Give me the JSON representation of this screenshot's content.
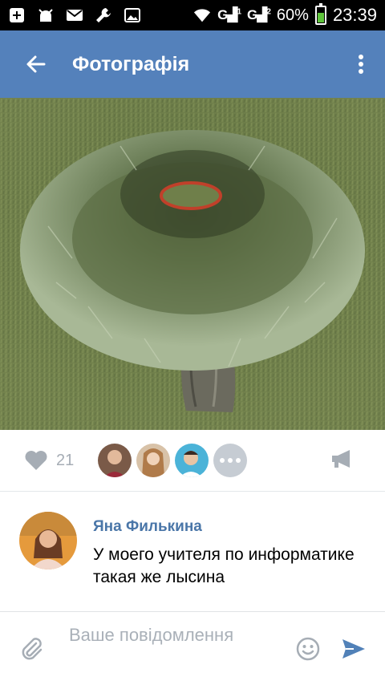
{
  "status_bar": {
    "battery": "60%",
    "time": "23:39",
    "signal_1": "G",
    "signal_2": "G",
    "signal_sim1": "1",
    "signal_sim2": "2",
    "icons": [
      "add-icon",
      "android-debug-icon",
      "mail-icon",
      "wrench-icon",
      "image-icon",
      "wifi-icon",
      "signal-icon",
      "signal-icon",
      "battery-icon"
    ],
    "battery_color": "#5ec43b"
  },
  "app_bar": {
    "title": "Фотографія",
    "back_icon": "arrow-left-icon",
    "menu_icon": "more-vertical-icon",
    "color": "#5481bb"
  },
  "photo": {
    "subject": "tree-photo"
  },
  "actions": {
    "like_count": "21",
    "like_icon": "heart-icon",
    "share_icon": "megaphone-icon",
    "likers_more_icon": "more-horizontal-icon"
  },
  "comment": {
    "author": "Яна Филькина",
    "text": "У моего учителя по информатике такая же лысина",
    "author_color": "#4a76a8"
  },
  "input_bar": {
    "placeholder": "Ваше повідомлення",
    "attach_icon": "paperclip-icon",
    "emoji_icon": "smiley-icon",
    "send_icon": "send-icon",
    "send_color": "#5181b8"
  }
}
